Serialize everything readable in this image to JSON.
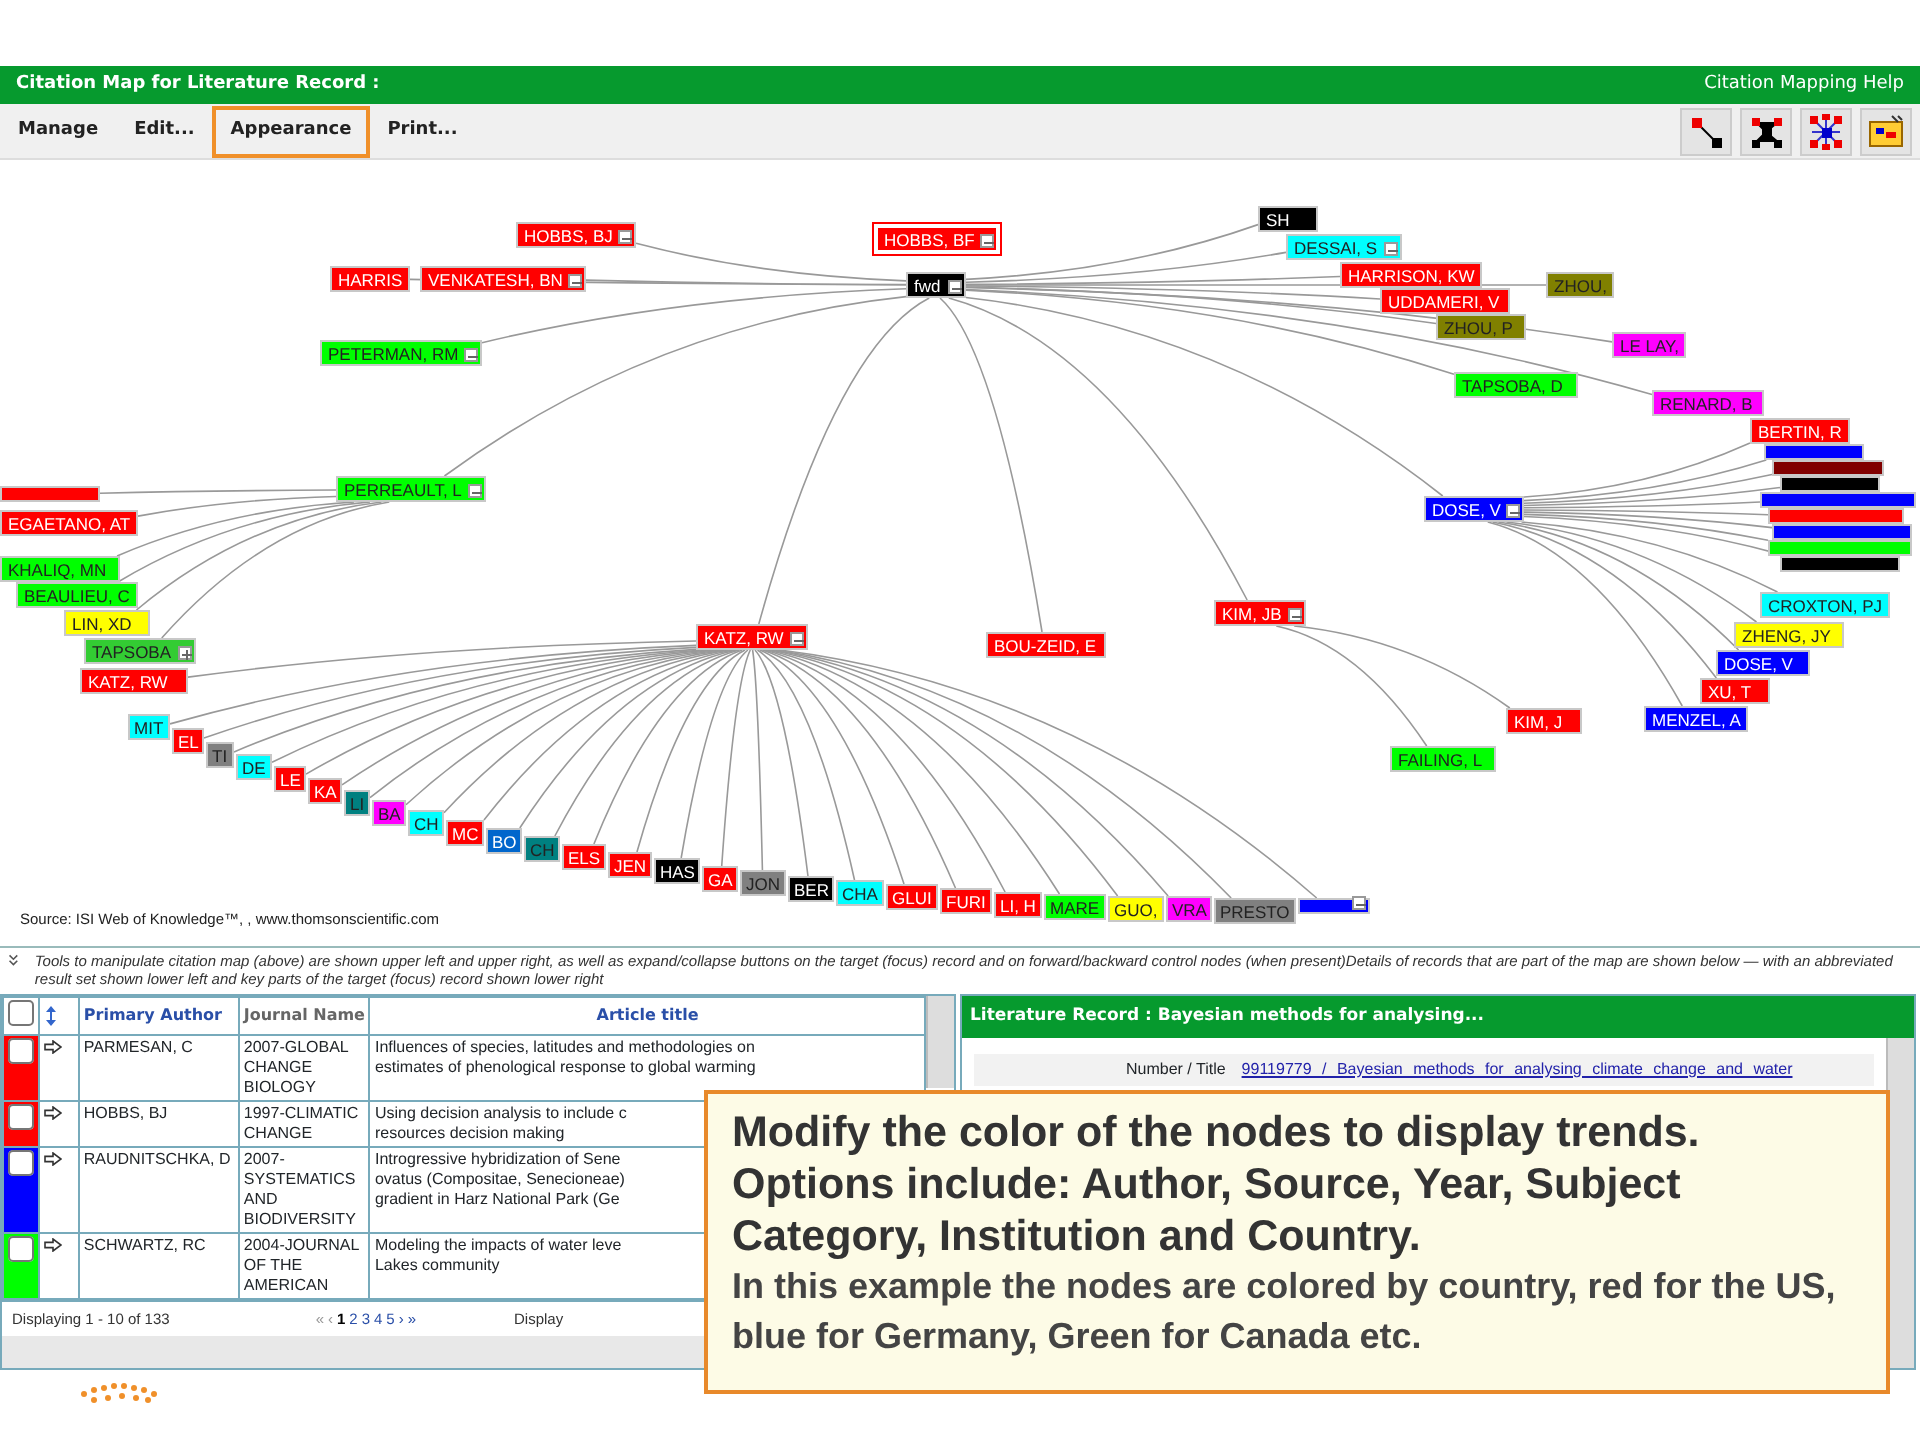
{
  "header": {
    "title": "Citation Map for  Literature Record :",
    "help_link": "Citation Mapping Help"
  },
  "menu": [
    {
      "label": "Manage",
      "selected": false
    },
    {
      "label": "Edit...",
      "selected": false
    },
    {
      "label": "Appearance",
      "selected": true
    },
    {
      "label": "Print...",
      "selected": false
    }
  ],
  "toolbar_buttons": [
    {
      "kind": "link"
    },
    {
      "kind": "cluster"
    },
    {
      "kind": "network"
    },
    {
      "kind": "chart"
    }
  ],
  "map": {
    "nodes": [
      {
        "label": "HOBBS, BF",
        "color": "#ff0000",
        "focus": true,
        "expanded": true
      },
      {
        "label": "fwd",
        "color": "#000000",
        "focus": false,
        "expanded": true
      },
      {
        "label": "HOBBS, BJ",
        "color": "#ff0000",
        "focus": false,
        "expanded": true
      },
      {
        "label": "HARRIS",
        "color": "#ff0000",
        "focus": false
      },
      {
        "label": "VENKATESH, BN",
        "color": "#ff0000",
        "focus": false,
        "expanded": true
      },
      {
        "label": "PETERMAN, RM",
        "color": "#00ff00",
        "focus": false,
        "expanded": true
      },
      {
        "label": "PERREAULT, L",
        "color": "#00ff00",
        "focus": false,
        "expanded": true
      },
      {
        "label": "KATZ, RW",
        "color": "#ff0000",
        "focus": false,
        "expanded": true
      },
      {
        "label": "BOU-ZEID, E",
        "color": "#ff0000",
        "focus": false
      },
      {
        "label": "KIM, JB",
        "color": "#ff0000",
        "focus": false,
        "expanded": true
      },
      {
        "label": "DOSE, V",
        "color": "#0000ff",
        "focus": false,
        "expanded": true
      },
      {
        "label": "SH",
        "color": "#000000",
        "focus": false
      },
      {
        "label": "DESSAI, S",
        "color": "#00ffff",
        "focus": false,
        "expanded": true
      },
      {
        "label": "HARRISON, KW",
        "color": "#ff0000",
        "focus": false
      },
      {
        "label": "UDDAMERI, V",
        "color": "#ff0000",
        "focus": false
      },
      {
        "label": "ZHOU, P",
        "color": "#808000",
        "focus": false
      },
      {
        "label": "ZHOU,",
        "color": "#808000",
        "focus": false
      },
      {
        "label": "LE LAY,",
        "color": "#ff00ff",
        "focus": false
      },
      {
        "label": "TAPSOBA, D",
        "color": "#00ff00",
        "focus": false
      },
      {
        "label": "RENARD, B",
        "color": "#ff00ff",
        "focus": false
      },
      {
        "label": "KIM, J",
        "color": "#ff0000",
        "focus": false
      },
      {
        "label": "FAILING, L",
        "color": "#00ff00",
        "focus": false
      },
      {
        "label": "BERTIN, R",
        "color": "#ff0000",
        "focus": false
      },
      {
        "label": "CROXTON, PJ",
        "color": "#00ffff",
        "focus": false
      },
      {
        "label": "ZHENG, JY",
        "color": "#ffff00",
        "focus": false
      },
      {
        "label": "DOSE, V",
        "color": "#0000ff",
        "focus": false
      },
      {
        "label": "XU, T",
        "color": "#ff0000",
        "focus": false
      },
      {
        "label": "MENZEL, A",
        "color": "#0000ff",
        "focus": false
      },
      {
        "label": "EGAETANO, AT",
        "color": "#ff0000",
        "focus": false
      },
      {
        "label": "KHALIQ, MN",
        "color": "#00ff00",
        "focus": false
      },
      {
        "label": "BEAULIEU, C",
        "color": "#00ff00",
        "focus": false
      },
      {
        "label": "LIN, XD",
        "color": "#ffff00",
        "focus": false
      },
      {
        "label": "TAPSOBA",
        "color": "#33cc33",
        "focus": false,
        "expanded": false
      },
      {
        "label": "KATZ, RW",
        "color": "#ff0000",
        "focus": false
      },
      {
        "label": "MIT",
        "color": "#00ffff",
        "focus": false
      },
      {
        "label": "EL",
        "color": "#ff0000",
        "focus": false
      },
      {
        "label": "TI",
        "color": "#808080",
        "focus": false
      },
      {
        "label": "DE",
        "color": "#00ffff",
        "focus": false
      },
      {
        "label": "LE",
        "color": "#ff0000",
        "focus": false
      },
      {
        "label": "KA",
        "color": "#ff0000",
        "focus": false
      },
      {
        "label": "LI",
        "color": "#008080",
        "focus": false
      },
      {
        "label": "BA",
        "color": "#ff00ff",
        "focus": false
      },
      {
        "label": "CH",
        "color": "#00ffff",
        "focus": false
      },
      {
        "label": "MC",
        "color": "#ff0000",
        "focus": false
      },
      {
        "label": "BO",
        "color": "#0066cc",
        "focus": false
      },
      {
        "label": "CH",
        "color": "#008080",
        "focus": false
      },
      {
        "label": "ELS",
        "color": "#ff0000",
        "focus": false
      },
      {
        "label": "JEN",
        "color": "#ff0000",
        "focus": false
      },
      {
        "label": "HAS",
        "color": "#000000",
        "focus": false
      },
      {
        "label": "GA",
        "color": "#ff0000",
        "focus": false
      },
      {
        "label": "JON",
        "color": "#808080",
        "focus": false
      },
      {
        "label": "BER",
        "color": "#000000",
        "focus": false
      },
      {
        "label": "CHA",
        "color": "#00ffff",
        "focus": false
      },
      {
        "label": "GLUI",
        "color": "#ff0000",
        "focus": false
      },
      {
        "label": "FURI",
        "color": "#ff0000",
        "focus": false
      },
      {
        "label": "LI, H",
        "color": "#ff0000",
        "focus": false
      },
      {
        "label": "MARE",
        "color": "#00ff00",
        "focus": false
      },
      {
        "label": "GUO,",
        "color": "#ffff00",
        "focus": false
      },
      {
        "label": "VRA",
        "color": "#ff00ff",
        "focus": false
      },
      {
        "label": "PRESTO",
        "color": "#808080",
        "focus": false
      },
      {
        "color": "#0000ff",
        "focus": false,
        "expanded": true
      },
      {
        "color": "#0000ff",
        "focus": false
      },
      {
        "color": "#800000",
        "focus": false
      },
      {
        "color": "#000000",
        "focus": false
      },
      {
        "color": "#0000ff",
        "focus": false
      },
      {
        "color": "#ff0000",
        "focus": false
      },
      {
        "color": "#0000ff",
        "focus": false
      },
      {
        "color": "#00ff00",
        "focus": false
      },
      {
        "color": "#000000",
        "focus": false
      },
      {
        "color": "#ff0000",
        "focus": false
      }
    ],
    "source": "Source: ISI Web of Knowledge™, , www.thomsonscientific.com"
  },
  "info": {
    "text": "Tools to manipulate citation map (above) are shown upper left and upper right, as well as expand/collapse buttons on the target (focus) record and on forward/backward control nodes (when present)Details of records that are part of the map are shown below — with an abbreviated result set shown lower left and key parts of the target (focus) record shown lower right"
  },
  "results": {
    "all_checked": false,
    "columns": [
      "Primary Author",
      "Journal Name",
      "Article title"
    ],
    "rows": [
      {
        "color": "#ff0000",
        "checked": false,
        "author": "PARMESAN, C",
        "journal": "2007-GLOBAL CHANGE BIOLOGY",
        "title": "Influences of species, latitudes and methodologies on\nestimates of phenological response to global warming"
      },
      {
        "color": "#ff0000",
        "checked": false,
        "author": "HOBBS, BJ",
        "journal": "1997-CLIMATIC CHANGE",
        "title": "Using decision analysis to include c\nresources decision making"
      },
      {
        "color": "#0000ff",
        "checked": false,
        "author": "RAUDNITSCHKA, D",
        "journal": "2007-SYSTEMATICS AND BIODIVERSITY",
        "title": "Introgressive hybridization of Sene\novatus (Compositae, Senecioneae)\ngradient in Harz National Park (Ge"
      },
      {
        "color": "#00ff00",
        "checked": false,
        "author": "SCHWARTZ, RC",
        "journal": "2004-JOURNAL OF THE AMERICAN",
        "title": "Modeling the impacts of water leve\nLakes community"
      }
    ],
    "count": "Displaying 1 - 10 of 133",
    "pager": [
      {
        "label": "«",
        "selected": false,
        "disabled": true
      },
      {
        "label": "‹",
        "selected": false,
        "disabled": true
      },
      {
        "label": "1",
        "selected": true,
        "disabled": false
      },
      {
        "label": "2",
        "selected": false,
        "disabled": false
      },
      {
        "label": "3",
        "selected": false,
        "disabled": false
      },
      {
        "label": "4",
        "selected": false,
        "disabled": false
      },
      {
        "label": "5",
        "selected": false,
        "disabled": false
      },
      {
        "label": "›",
        "selected": false,
        "disabled": false
      },
      {
        "label": "»",
        "selected": false,
        "disabled": false
      }
    ],
    "display_label": "Display"
  },
  "record": {
    "title": "Literature Record : Bayesian methods for analysing...",
    "field_label": "Number / Title",
    "field_value": "99119779 / Bayesian methods for analysing climate change and water"
  },
  "callout": {
    "heading": "Modify the color of the nodes to display trends. Options include: Author, Source, Year, Subject Category, Institution and Country.",
    "body": "In this example the nodes are colored by country, red for the US, blue for Germany, Green for Canada etc."
  }
}
